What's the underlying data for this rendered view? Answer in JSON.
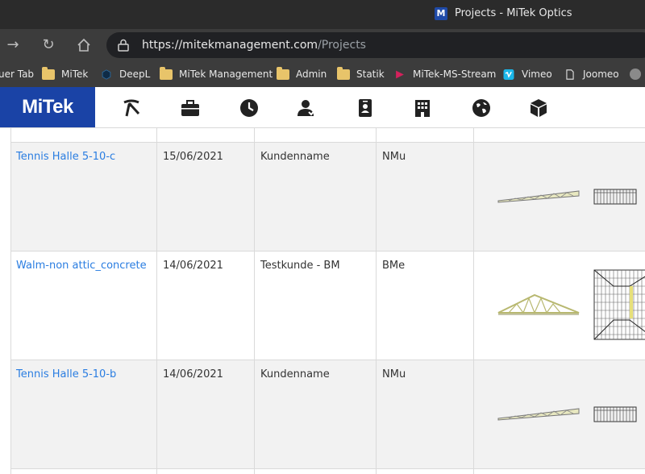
{
  "window": {
    "title": "Projects - MiTek Optics",
    "favicon_letter": "M"
  },
  "addressbar": {
    "url_host": "https://mitekmanagement.com",
    "url_path": "/Projects"
  },
  "bookmarks": [
    {
      "label": "uer Tab",
      "icon": "tab-icon"
    },
    {
      "label": "MiTek",
      "icon": "folder-icon"
    },
    {
      "label": "DeepL",
      "icon": "deepl-icon"
    },
    {
      "label": "MiTek Management",
      "icon": "folder-icon"
    },
    {
      "label": "Admin",
      "icon": "folder-icon"
    },
    {
      "label": "Statik",
      "icon": "folder-icon"
    },
    {
      "label": "MiTek-MS-Stream",
      "icon": "stream-icon"
    },
    {
      "label": "Vimeo",
      "icon": "vimeo-icon"
    },
    {
      "label": "Joomeo",
      "icon": "page-icon"
    }
  ],
  "app": {
    "logo": "MiTek",
    "nav": [
      "gauge-icon",
      "briefcase-icon",
      "clock-icon",
      "users-icon",
      "id-badge-icon",
      "building-icon",
      "globe-icon",
      "box-icon"
    ]
  },
  "projects": [
    {
      "name": "Tennis Halle 5-10-c",
      "date": "15/06/2021",
      "customer": "Kundenname",
      "user": "NMu",
      "thumbnail": "flat-truss"
    },
    {
      "name": "Walm-non attic_concrete",
      "date": "14/06/2021",
      "customer": "Testkunde - BM",
      "user": "BMe",
      "thumbnail": "gable-truss"
    },
    {
      "name": "Tennis Halle 5-10-b",
      "date": "14/06/2021",
      "customer": "Kundenname",
      "user": "NMu",
      "thumbnail": "flat-truss"
    }
  ],
  "colors": {
    "brand_blue": "#1a43a6",
    "link_blue": "#2a7de1",
    "row_shade": "#f2f2f2"
  }
}
